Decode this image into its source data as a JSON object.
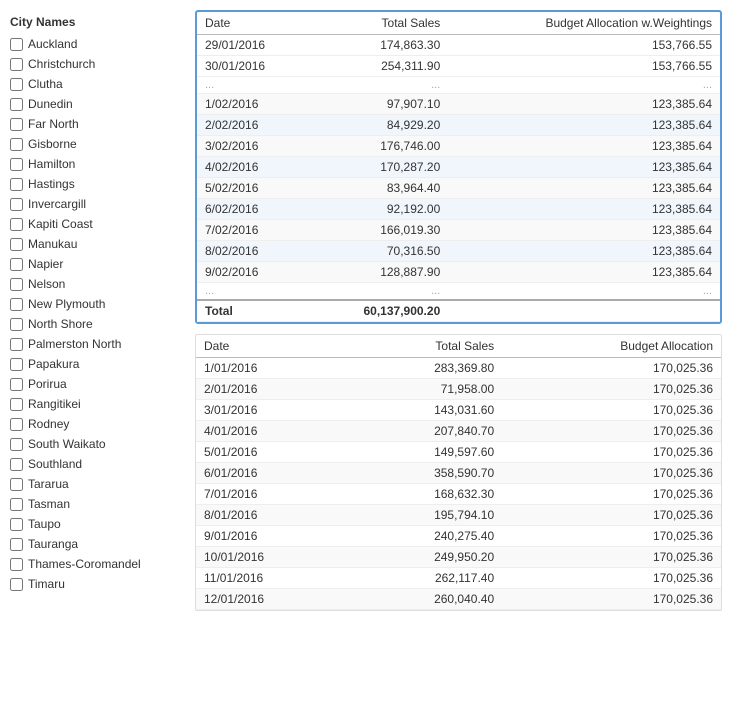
{
  "sidebar": {
    "title": "City Names",
    "cities": [
      {
        "label": "Auckland",
        "checked": false
      },
      {
        "label": "Christchurch",
        "checked": false
      },
      {
        "label": "Clutha",
        "checked": false
      },
      {
        "label": "Dunedin",
        "checked": false
      },
      {
        "label": "Far North",
        "checked": false
      },
      {
        "label": "Gisborne",
        "checked": false
      },
      {
        "label": "Hamilton",
        "checked": false
      },
      {
        "label": "Hastings",
        "checked": false
      },
      {
        "label": "Invercargill",
        "checked": false
      },
      {
        "label": "Kapiti Coast",
        "checked": false
      },
      {
        "label": "Manukau",
        "checked": false
      },
      {
        "label": "Napier",
        "checked": false
      },
      {
        "label": "Nelson",
        "checked": false
      },
      {
        "label": "New Plymouth",
        "checked": false
      },
      {
        "label": "North Shore",
        "checked": false
      },
      {
        "label": "Palmerston North",
        "checked": false
      },
      {
        "label": "Papakura",
        "checked": false
      },
      {
        "label": "Porirua",
        "checked": false
      },
      {
        "label": "Rangitikei",
        "checked": false
      },
      {
        "label": "Rodney",
        "checked": false
      },
      {
        "label": "South Waikato",
        "checked": false
      },
      {
        "label": "Southland",
        "checked": false
      },
      {
        "label": "Tararua",
        "checked": false
      },
      {
        "label": "Tasman",
        "checked": false
      },
      {
        "label": "Taupo",
        "checked": false
      },
      {
        "label": "Tauranga",
        "checked": false
      },
      {
        "label": "Thames-Coromandel",
        "checked": false
      },
      {
        "label": "Timaru",
        "checked": false
      }
    ]
  },
  "table1": {
    "highlighted": true,
    "headers": [
      "Date",
      "Total Sales",
      "Budget Allocation w.Weightings"
    ],
    "partial_rows_top": [
      {
        "date": "29/01/2016",
        "sales": "174,863.30",
        "budget": "153,766.55"
      },
      {
        "date": "30/01/2016",
        "sales": "254,311.90",
        "budget": "153,766.55"
      }
    ],
    "partial_ellipsis": true,
    "rows": [
      {
        "date": "1/02/2016",
        "sales": "97,907.10",
        "budget": "123,385.64"
      },
      {
        "date": "2/02/2016",
        "sales": "84,929.20",
        "budget": "123,385.64"
      },
      {
        "date": "3/02/2016",
        "sales": "176,746.00",
        "budget": "123,385.64"
      },
      {
        "date": "4/02/2016",
        "sales": "170,287.20",
        "budget": "123,385.64"
      },
      {
        "date": "5/02/2016",
        "sales": "83,964.40",
        "budget": "123,385.64"
      },
      {
        "date": "6/02/2016",
        "sales": "92,192.00",
        "budget": "123,385.64"
      },
      {
        "date": "7/02/2016",
        "sales": "166,019.30",
        "budget": "123,385.64"
      },
      {
        "date": "8/02/2016",
        "sales": "70,316.50",
        "budget": "123,385.64"
      },
      {
        "date": "9/02/2016",
        "sales": "128,887.90",
        "budget": "123,385.64"
      }
    ],
    "partial_ellipsis_bottom": true,
    "total": {
      "label": "Total",
      "sales": "60,137,900.20",
      "budget": ""
    }
  },
  "table2": {
    "highlighted": false,
    "headers": [
      "Date",
      "Total Sales",
      "Budget Allocation"
    ],
    "rows": [
      {
        "date": "1/01/2016",
        "sales": "283,369.80",
        "budget": "170,025.36"
      },
      {
        "date": "2/01/2016",
        "sales": "71,958.00",
        "budget": "170,025.36"
      },
      {
        "date": "3/01/2016",
        "sales": "143,031.60",
        "budget": "170,025.36"
      },
      {
        "date": "4/01/2016",
        "sales": "207,840.70",
        "budget": "170,025.36"
      },
      {
        "date": "5/01/2016",
        "sales": "149,597.60",
        "budget": "170,025.36"
      },
      {
        "date": "6/01/2016",
        "sales": "358,590.70",
        "budget": "170,025.36"
      },
      {
        "date": "7/01/2016",
        "sales": "168,632.30",
        "budget": "170,025.36"
      },
      {
        "date": "8/01/2016",
        "sales": "195,794.10",
        "budget": "170,025.36"
      },
      {
        "date": "9/01/2016",
        "sales": "240,275.40",
        "budget": "170,025.36"
      },
      {
        "date": "10/01/2016",
        "sales": "249,950.20",
        "budget": "170,025.36"
      },
      {
        "date": "11/01/2016",
        "sales": "262,117.40",
        "budget": "170,025.36"
      },
      {
        "date": "12/01/2016",
        "sales": "260,040.40",
        "budget": "170,025.36"
      }
    ]
  }
}
